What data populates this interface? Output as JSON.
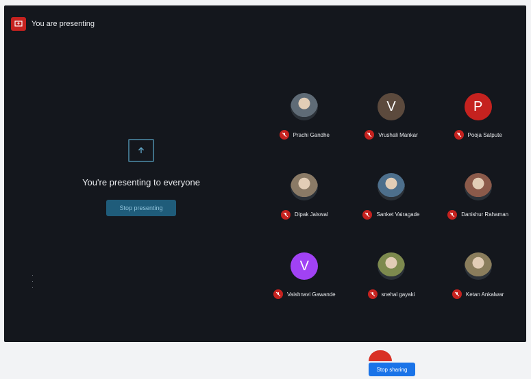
{
  "topbar": {
    "title": "You are presenting"
  },
  "presenting": {
    "message": "You're presenting to everyone",
    "stop_button_label": "Stop presenting"
  },
  "participants": [
    {
      "name": "Prachi Gandhe",
      "avatar_type": "photo",
      "initial": "",
      "avatar_color": "#5f6b76",
      "mic": "muted"
    },
    {
      "name": "Vrushali Mankar",
      "avatar_type": "letter",
      "initial": "V",
      "avatar_color": "#5c4a3d",
      "mic": "muted"
    },
    {
      "name": "Pooja Satpute",
      "avatar_type": "letter",
      "initial": "P",
      "avatar_color": "#c5221f",
      "mic": "muted"
    },
    {
      "name": "Dipak Jaiswal",
      "avatar_type": "photo",
      "initial": "",
      "avatar_color": "#8a7a66",
      "mic": "muted"
    },
    {
      "name": "Sanket Vairagade",
      "avatar_type": "photo",
      "initial": "",
      "avatar_color": "#4d6f8c",
      "mic": "muted"
    },
    {
      "name": "Danishur Rahaman",
      "avatar_type": "photo",
      "initial": "",
      "avatar_color": "#8b5a4a",
      "mic": "muted"
    },
    {
      "name": "Vaishnavi Gawande",
      "avatar_type": "letter",
      "initial": "V",
      "avatar_color": "#a142f4",
      "mic": "muted"
    },
    {
      "name": "snehal gayaki",
      "avatar_type": "photo",
      "initial": "",
      "avatar_color": "#7d8a4e",
      "mic": "muted"
    },
    {
      "name": "Ketan Ankalwar",
      "avatar_type": "photo",
      "initial": "",
      "avatar_color": "#8a7d5c",
      "mic": "muted"
    }
  ],
  "bottom": {
    "stop_sharing_label": "Stop sharing"
  },
  "colors": {
    "accent": "#1a73e8",
    "danger": "#c5221f",
    "background": "#14171d"
  }
}
